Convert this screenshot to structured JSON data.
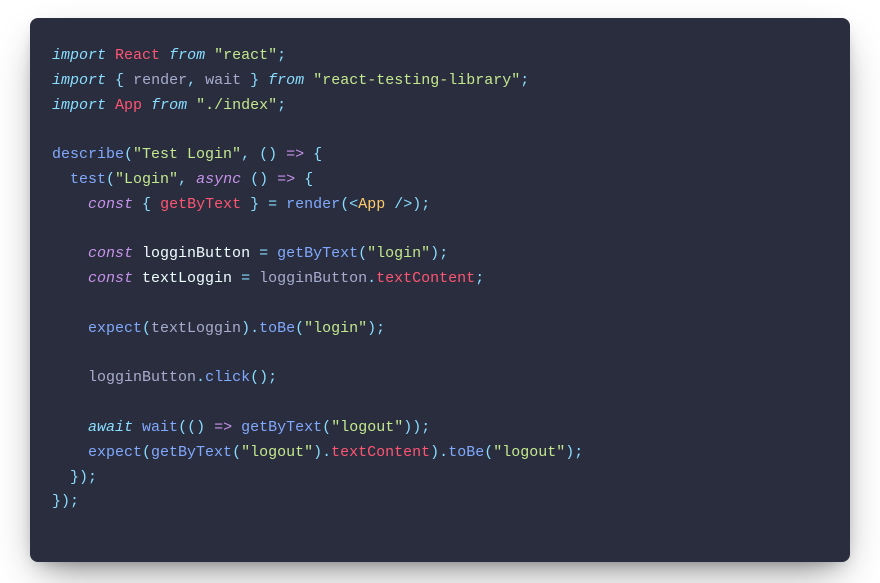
{
  "code": {
    "t1": "import",
    "t2": "React",
    "t3": "from",
    "t4": "\"react\"",
    "t5": ";",
    "t6": "import",
    "t7": "{",
    "t8": "render",
    "t9": ",",
    "t10": "wait",
    "t11": "}",
    "t12": "from",
    "t13": "\"react-testing-library\"",
    "t14": ";",
    "t15": "import",
    "t16": "App",
    "t17": "from",
    "t18": "\"./index\"",
    "t19": ";",
    "t20": "describe",
    "t21": "(",
    "t22": "\"Test Login\"",
    "t23": ",",
    "t24": "(",
    "t25": ")",
    "t26": "=>",
    "t27": "{",
    "t28": "test",
    "t29": "(",
    "t30": "\"Login\"",
    "t31": ",",
    "t32": "async",
    "t33": "(",
    "t34": ")",
    "t35": "=>",
    "t36": "{",
    "t37": "const",
    "t38": "{",
    "t39": "getByText",
    "t40": "}",
    "t41": "=",
    "t42": "render",
    "t43": "(",
    "t44": "<",
    "t45": "App",
    "t46": "/>",
    "t47": ")",
    "t48": ";",
    "t49": "const",
    "t50": "logginButton",
    "t51": "=",
    "t52": "getByText",
    "t53": "(",
    "t54": "\"login\"",
    "t55": ")",
    "t56": ";",
    "t57": "const",
    "t58": "textLoggin",
    "t59": "=",
    "t60": "logginButton",
    "t61": ".",
    "t62": "textContent",
    "t63": ";",
    "t64": "expect",
    "t65": "(",
    "t66": "textLoggin",
    "t67": ")",
    "t68": ".",
    "t69": "toBe",
    "t70": "(",
    "t71": "\"login\"",
    "t72": ")",
    "t73": ";",
    "t74": "logginButton",
    "t75": ".",
    "t76": "click",
    "t77": "(",
    "t78": ")",
    "t79": ";",
    "t80": "await",
    "t81": "wait",
    "t82": "(",
    "t83": "(",
    "t84": ")",
    "t85": "=>",
    "t86": "getByText",
    "t87": "(",
    "t88": "\"logout\"",
    "t89": ")",
    "t90": ")",
    "t91": ";",
    "t92": "expect",
    "t93": "(",
    "t94": "getByText",
    "t95": "(",
    "t96": "\"logout\"",
    "t97": ")",
    "t98": ".",
    "t99": "textContent",
    "t100": ")",
    "t101": ".",
    "t102": "toBe",
    "t103": "(",
    "t104": "\"logout\"",
    "t105": ")",
    "t106": ";",
    "t107": "}",
    "t108": ")",
    "t109": ";",
    "t110": "}",
    "t111": ")",
    "t112": ";"
  }
}
